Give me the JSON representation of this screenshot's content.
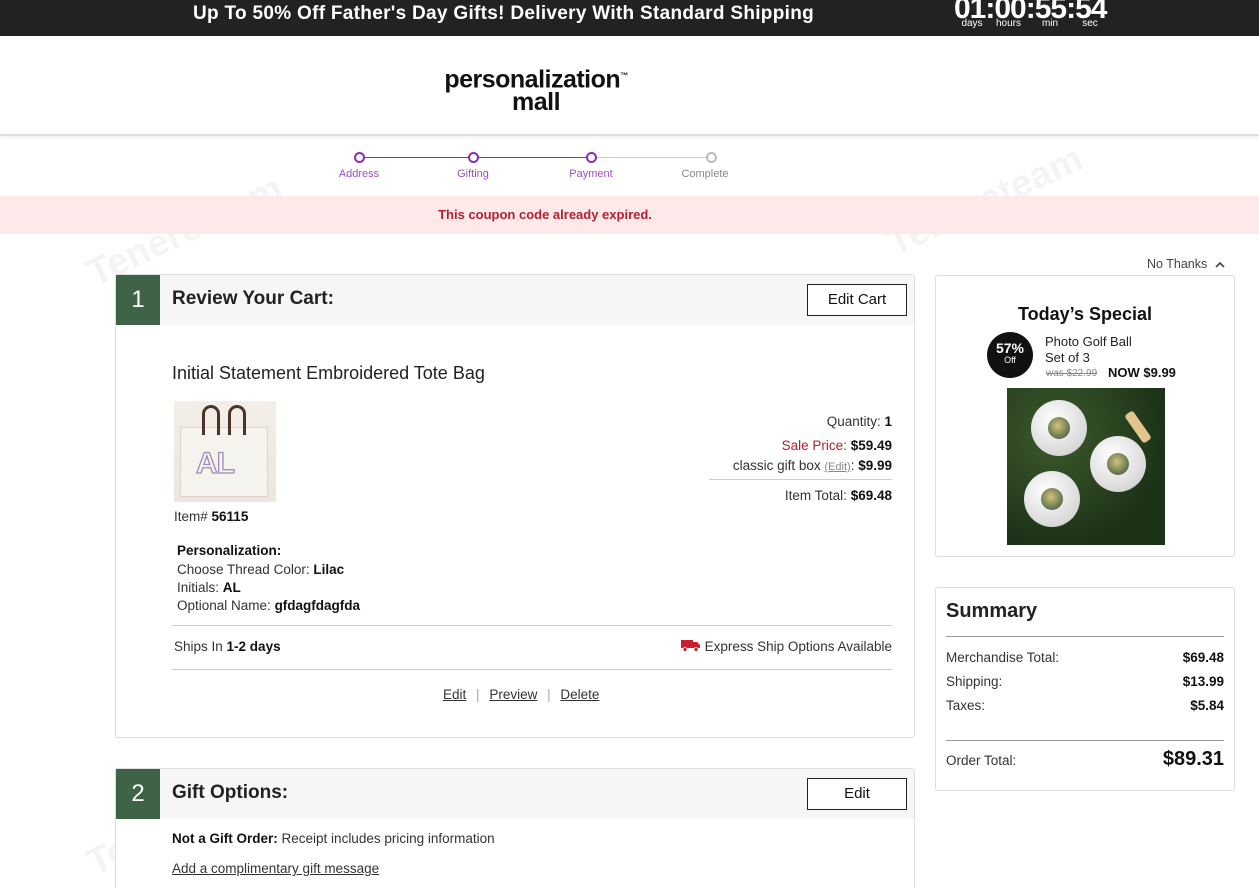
{
  "promo": {
    "text": "Up To 50% Off Father's Day Gifts! Delivery With Standard Shipping",
    "timer": "01:00:55:54",
    "timer_labels": [
      "days",
      "hours",
      "min",
      "sec"
    ]
  },
  "logo": {
    "line1": "personalization",
    "line2": "mall",
    "trademark": "™"
  },
  "steps": [
    {
      "label": "Address",
      "state": "done"
    },
    {
      "label": "Gifting",
      "state": "done"
    },
    {
      "label": "Payment",
      "state": "active"
    },
    {
      "label": "Complete",
      "state": "pending"
    }
  ],
  "alert": {
    "message": "This coupon code already expired."
  },
  "cart": {
    "step_number": "1",
    "title": "Review Your Cart:",
    "edit_button": "Edit Cart",
    "product_name": "Initial Statement Embroidered Tote Bag",
    "image_initials": "AL",
    "item_number_label": "Item#",
    "item_number": "56115",
    "quantity_label": "Quantity:",
    "quantity": "1",
    "sale_price_label": "Sale Price:",
    "sale_price": "$59.49",
    "gift_box_label": "classic gift box",
    "gift_box_edit": "(Edit)",
    "gift_box_price": "$9.99",
    "item_total_label": "Item Total:",
    "item_total": "$69.48",
    "personalization_heading": "Personalization:",
    "thread_label": "Choose Thread Color:",
    "thread_value": "Lilac",
    "initials_label": "Initials:",
    "initials_value": "AL",
    "optional_name_label": "Optional Name:",
    "optional_name_value": "gfdagfdagfda",
    "ships_in_label": "Ships In",
    "ships_in_value": "1-2 days",
    "express_text": "Express Ship Options Available",
    "actions": {
      "edit": "Edit",
      "preview": "Preview",
      "delete": "Delete"
    }
  },
  "gift_options": {
    "step_number": "2",
    "title": "Gift Options:",
    "edit_button": "Edit",
    "not_gift_label": "Not a Gift Order:",
    "not_gift_text": "Receipt includes pricing information",
    "gift_message_link": "Add a complimentary gift message"
  },
  "special": {
    "no_thanks": "No Thanks",
    "title": "Today’s Special",
    "badge_pct": "57%",
    "badge_off": "Off",
    "product_line1": "Photo Golf Ball",
    "product_line2": "Set of 3",
    "was_price": "was $22.99",
    "now_price": "NOW $9.99"
  },
  "summary": {
    "title": "Summary",
    "merch_label": "Merchandise Total:",
    "merch_value": "$69.48",
    "shipping_label": "Shipping:",
    "shipping_value": "$13.99",
    "taxes_label": "Taxes:",
    "taxes_value": "$5.84",
    "order_total_label": "Order Total:",
    "order_total_value": "$89.31"
  },
  "colors": {
    "accent_purple": "#8a2fb2",
    "step_green": "#3e6347",
    "error_red": "#b3202e",
    "alert_bg": "#fde8ea",
    "promo_bg": "#222222"
  },
  "watermark": "Tenereteam"
}
